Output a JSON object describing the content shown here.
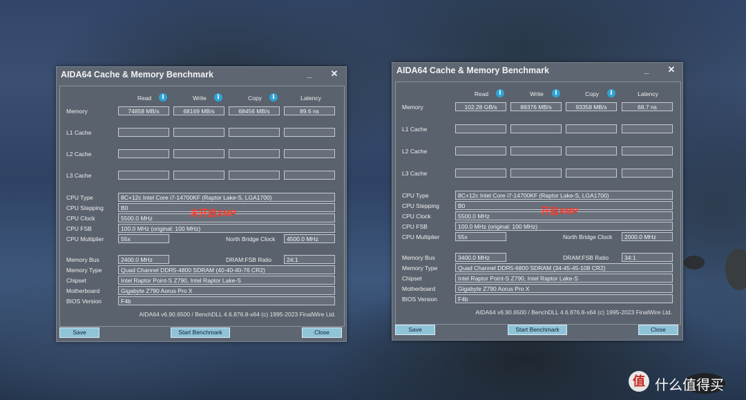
{
  "windows": [
    {
      "title": "AIDA64 Cache & Memory Benchmark",
      "controls": {
        "minimize": "_",
        "close": "✕"
      },
      "headers": {
        "read": "Read",
        "write": "Write",
        "copy": "Copy",
        "latency": "Latency"
      },
      "rows": [
        {
          "label": "Memory",
          "values": [
            "74858 MB/s",
            "68169 MB/s",
            "68456 MB/s",
            "89.6 ns"
          ]
        },
        {
          "label": "L1 Cache",
          "values": [
            "",
            "",
            "",
            ""
          ]
        },
        {
          "label": "L2 Cache",
          "values": [
            "",
            "",
            "",
            ""
          ]
        },
        {
          "label": "L3 Cache",
          "values": [
            "",
            "",
            "",
            ""
          ]
        }
      ],
      "cpu": {
        "type_label": "CPU Type",
        "type_value": "8C+12c Intel Core i7-14700KF  (Raptor Lake-S, LGA1700)",
        "stepping_label": "CPU Stepping",
        "stepping_value": "B0",
        "clock_label": "CPU Clock",
        "clock_value": "5500.0 MHz",
        "fsb_label": "CPU FSB",
        "fsb_value": "100.0 MHz  (original: 100 MHz)",
        "multiplier_label": "CPU Multiplier",
        "multiplier_value": "55x",
        "nb_label": "North Bridge Clock",
        "nb_value": "4500.0 MHz"
      },
      "mem": {
        "bus_label": "Memory Bus",
        "bus_value": "2400.0 MHz",
        "ratio_label": "DRAM:FSB Ratio",
        "ratio_value": "24:1",
        "type_label": "Memory Type",
        "type_value": "Quad Channel DDR5-4800 SDRAM  (40-40-40-76 CR2)",
        "chipset_label": "Chipset",
        "chipset_value": "Intel Raptor Point-S Z790, Intel Raptor Lake-S",
        "mb_label": "Motherboard",
        "mb_value": "Gigabyte Z790 Aorus Pro X",
        "bios_label": "BIOS Version",
        "bios_value": "F4b"
      },
      "footer": "AIDA64 v6.90.6500 / BenchDLL 4.6.876.8-x64  (c) 1995-2023 FinalWire Ltd.",
      "overlay": "未开启XMP",
      "buttons": {
        "save": "Save",
        "start": "Start Benchmark",
        "close": "Close"
      }
    },
    {
      "title": "AIDA64 Cache & Memory Benchmark",
      "controls": {
        "minimize": "_",
        "close": "✕"
      },
      "headers": {
        "read": "Read",
        "write": "Write",
        "copy": "Copy",
        "latency": "Latency"
      },
      "rows": [
        {
          "label": "Memory",
          "values": [
            "102.28 GB/s",
            "89376 MB/s",
            "93358 MB/s",
            "68.7 ns"
          ]
        },
        {
          "label": "L1 Cache",
          "values": [
            "",
            "",
            "",
            ""
          ]
        },
        {
          "label": "L2 Cache",
          "values": [
            "",
            "",
            "",
            ""
          ]
        },
        {
          "label": "L3 Cache",
          "values": [
            "",
            "",
            "",
            ""
          ]
        }
      ],
      "cpu": {
        "type_label": "CPU Type",
        "type_value": "8C+12c Intel Core i7-14700KF  (Raptor Lake-S, LGA1700)",
        "stepping_label": "CPU Stepping",
        "stepping_value": "B0",
        "clock_label": "CPU Clock",
        "clock_value": "5500.0 MHz",
        "fsb_label": "CPU FSB",
        "fsb_value": "100.0 MHz  (original: 100 MHz)",
        "multiplier_label": "CPU Multiplier",
        "multiplier_value": "55x",
        "nb_label": "North Bridge Clock",
        "nb_value": "2000.0 MHz"
      },
      "mem": {
        "bus_label": "Memory Bus",
        "bus_value": "3400.0 MHz",
        "ratio_label": "DRAM:FSB Ratio",
        "ratio_value": "34:1",
        "type_label": "Memory Type",
        "type_value": "Quad Channel DDR5-6800 SDRAM  (34-45-45-108 CR2)",
        "chipset_label": "Chipset",
        "chipset_value": "Intel Raptor Point-S Z790, Intel Raptor Lake-S",
        "mb_label": "Motherboard",
        "mb_value": "Gigabyte Z790 Aorus Pro X",
        "bios_label": "BIOS Version",
        "bios_value": "F4b"
      },
      "footer": "AIDA64 v6.90.6500 / BenchDLL 4.6.876.8-x64  (c) 1995-2023 FinalWire Ltd.",
      "overlay": "开启XMP",
      "buttons": {
        "save": "Save",
        "start": "Start Benchmark",
        "close": "Close"
      }
    }
  ],
  "watermark": {
    "icon": "值",
    "text": "什么值得买"
  },
  "colors": {
    "info_icon": "#2ea3d6",
    "button": "#8fc3d8",
    "overlay_text": "#ff3b2a"
  }
}
